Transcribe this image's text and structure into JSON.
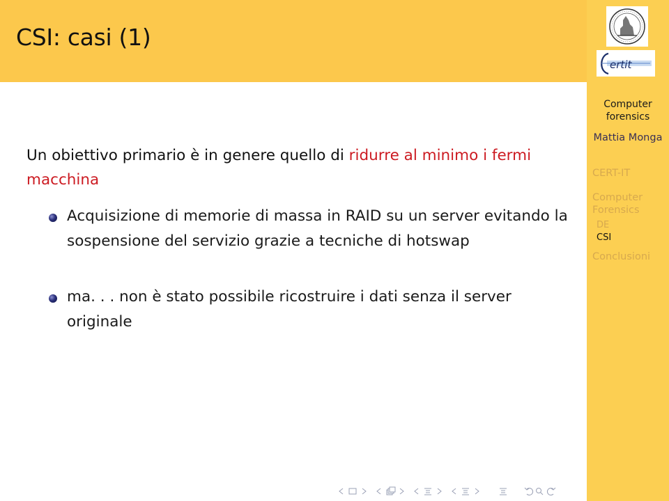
{
  "slide": {
    "title": "CSI: casi (1)",
    "intro": {
      "normal": "Un obiettivo primario è in genere quello di ",
      "highlight": "ridurre al minimo i fermi macchina",
      "highlight_color": "#cc1b22"
    },
    "bullets": [
      {
        "text": "Acquisizione di memorie di massa in RAID su un server evitando la sospensione del servizio grazie a tecniche di hotswap"
      },
      {
        "text": "ma. . . non è stato possibile ricostruire i dati senza il server originale"
      }
    ]
  },
  "sidebar": {
    "logos": [
      "university-seal-logo",
      "cert-it-logo"
    ],
    "presentation_title": "Computer forensics",
    "author": "Mattia Monga",
    "sections": [
      {
        "label": "CERT-IT",
        "active": false,
        "subsections": []
      },
      {
        "label": "Computer Forensics",
        "active": true,
        "subsections": [
          {
            "label": "DE",
            "active": false
          },
          {
            "label": "CSI",
            "active": true
          }
        ]
      },
      {
        "label": "Conclusioni",
        "active": false,
        "subsections": []
      }
    ]
  },
  "navigation": {
    "icons": [
      "nav-prev-frame-icon",
      "frame-icon",
      "nav-next-frame-icon",
      "nav-prev-subsection-icon",
      "subsection-icon",
      "nav-next-subsection-icon",
      "nav-prev-section-icon",
      "section-icon",
      "nav-next-section-icon",
      "presentation-icon",
      "nav-back-icon",
      "search-icon",
      "nav-forward-icon"
    ]
  },
  "colors": {
    "header_bg": "#fcc84c",
    "sidebar_bg": "#fccf52",
    "inactive_section": "#d7a94e",
    "accent_red": "#cc1b22"
  }
}
